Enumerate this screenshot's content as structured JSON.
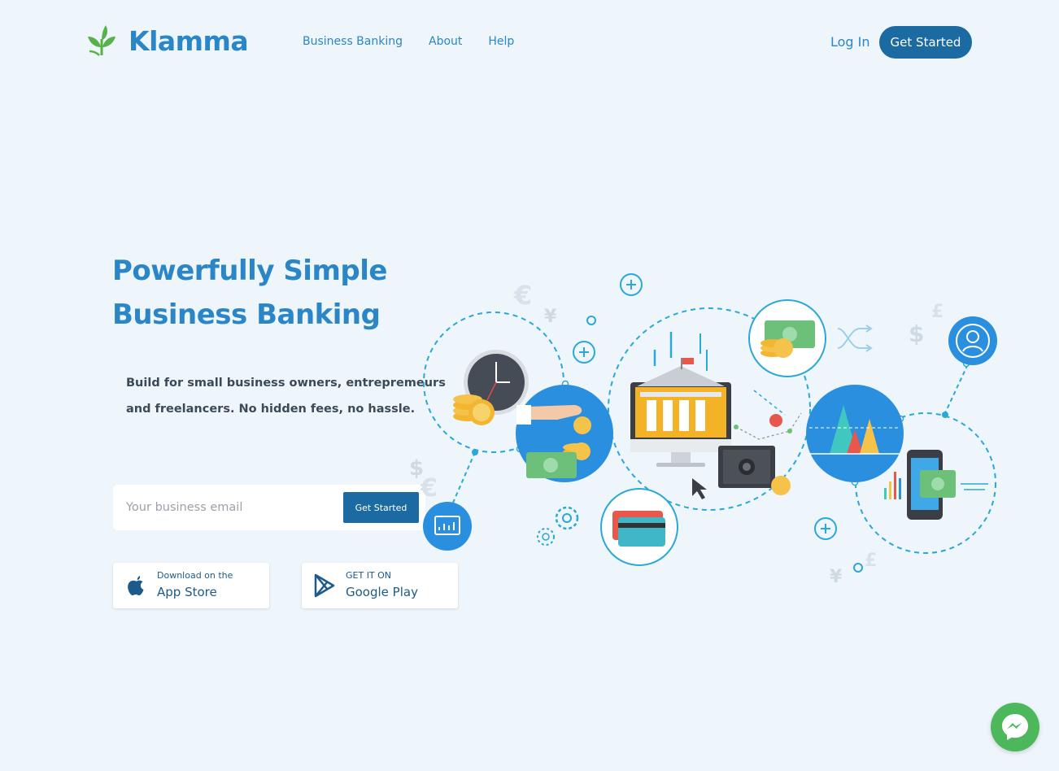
{
  "brand": {
    "name": "Klamma",
    "color": "#2a86c6",
    "accent": "#1b6aa2",
    "leaf_color": "#58b14a"
  },
  "nav": {
    "links": [
      "Business Banking",
      "About",
      "Help"
    ],
    "login": "Log In",
    "cta": "Get Started"
  },
  "hero": {
    "title_line1": "Powerfully Simple",
    "title_line2": "Business Banking",
    "subtitle": "Build for small business owners, entrepremeurs and freelancers. No hidden fees, no hassle."
  },
  "signup": {
    "placeholder": "Your business email",
    "button": "Get Started"
  },
  "stores": {
    "apple": {
      "small": "Download on the",
      "big": "App Store",
      "icon": "apple-icon"
    },
    "google": {
      "small": "GET IT ON",
      "big": "Google Play",
      "icon": "google-play-icon"
    }
  },
  "chat": {
    "icon": "messenger-icon",
    "color": "#4db85b"
  }
}
